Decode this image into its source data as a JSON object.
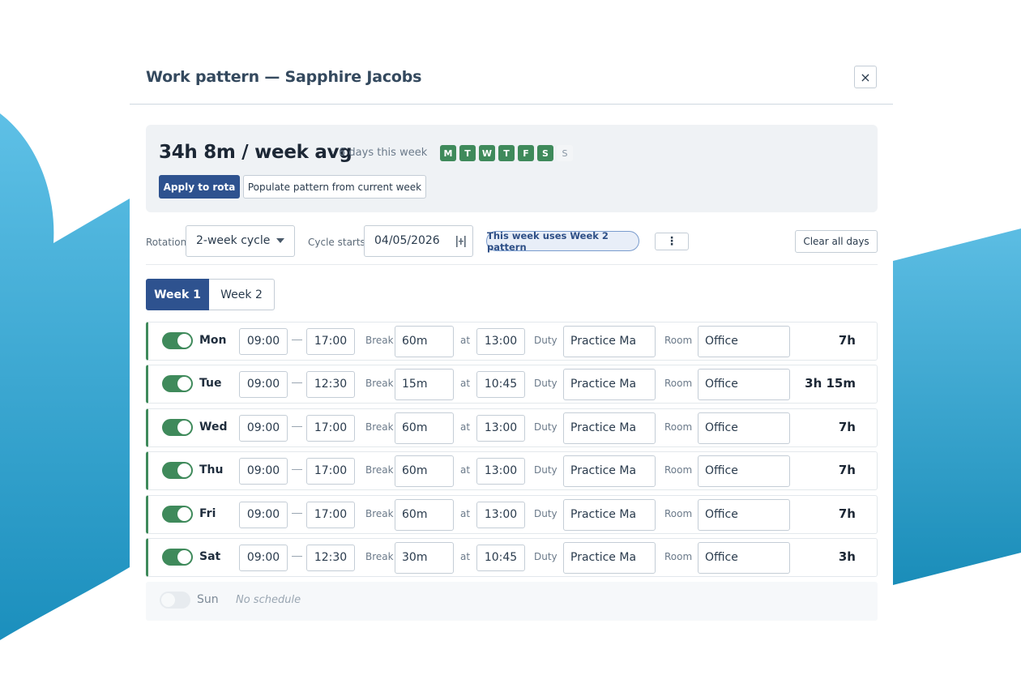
{
  "modal": {
    "title": "Work pattern — Sapphire Jacobs",
    "close_icon": "×"
  },
  "summary": {
    "average": "34h 8m / week avg",
    "separator": "·",
    "days_this_week": "6 days this week",
    "day_chips": [
      {
        "letter": "M",
        "active": true
      },
      {
        "letter": "T",
        "active": true
      },
      {
        "letter": "W",
        "active": true
      },
      {
        "letter": "T",
        "active": true
      },
      {
        "letter": "F",
        "active": true
      },
      {
        "letter": "S",
        "active": true
      },
      {
        "letter": "S",
        "active": false
      }
    ],
    "apply_label": "Apply to rota",
    "populate_label": "Populate pattern from current week"
  },
  "toolbar": {
    "rotation_label": "Rotation",
    "rotation_value": "2-week cycle",
    "cycle_label": "Cycle starts",
    "cycle_value": "04/05/2026",
    "pattern_badge": "This week uses Week 2 pattern",
    "more_icon": "⋮",
    "clear_label": "Clear all days"
  },
  "tabs": [
    {
      "label": "Week 1",
      "active": true
    },
    {
      "label": "Week 2",
      "active": false
    }
  ],
  "labels": {
    "break": "Break",
    "at": "at",
    "duty": "Duty",
    "room": "Room"
  },
  "rows": [
    {
      "day": "Mon",
      "enabled": true,
      "start": "09:00",
      "end": "17:00",
      "break": "60m",
      "at": "13:00",
      "duty": "Practice Ma",
      "room": "Office",
      "hours": "7h"
    },
    {
      "day": "Tue",
      "enabled": true,
      "start": "09:00",
      "end": "12:30",
      "break": "15m",
      "at": "10:45",
      "duty": "Practice Ma",
      "room": "Office",
      "hours": "3h 15m"
    },
    {
      "day": "Wed",
      "enabled": true,
      "start": "09:00",
      "end": "17:00",
      "break": "60m",
      "at": "13:00",
      "duty": "Practice Ma",
      "room": "Office",
      "hours": "7h"
    },
    {
      "day": "Thu",
      "enabled": true,
      "start": "09:00",
      "end": "17:00",
      "break": "60m",
      "at": "13:00",
      "duty": "Practice Ma",
      "room": "Office",
      "hours": "7h"
    },
    {
      "day": "Fri",
      "enabled": true,
      "start": "09:00",
      "end": "17:00",
      "break": "60m",
      "at": "13:00",
      "duty": "Practice Ma",
      "room": "Office",
      "hours": "7h"
    },
    {
      "day": "Sat",
      "enabled": true,
      "start": "09:00",
      "end": "12:30",
      "break": "30m",
      "at": "10:45",
      "duty": "Practice Ma",
      "room": "Office",
      "hours": "3h"
    }
  ],
  "sunday": {
    "day": "Sun",
    "enabled": false,
    "note": "No schedule"
  },
  "colors": {
    "primary": "#2e528f",
    "active_green": "#3f8a5b",
    "background_blue": "#2a9bd0"
  }
}
